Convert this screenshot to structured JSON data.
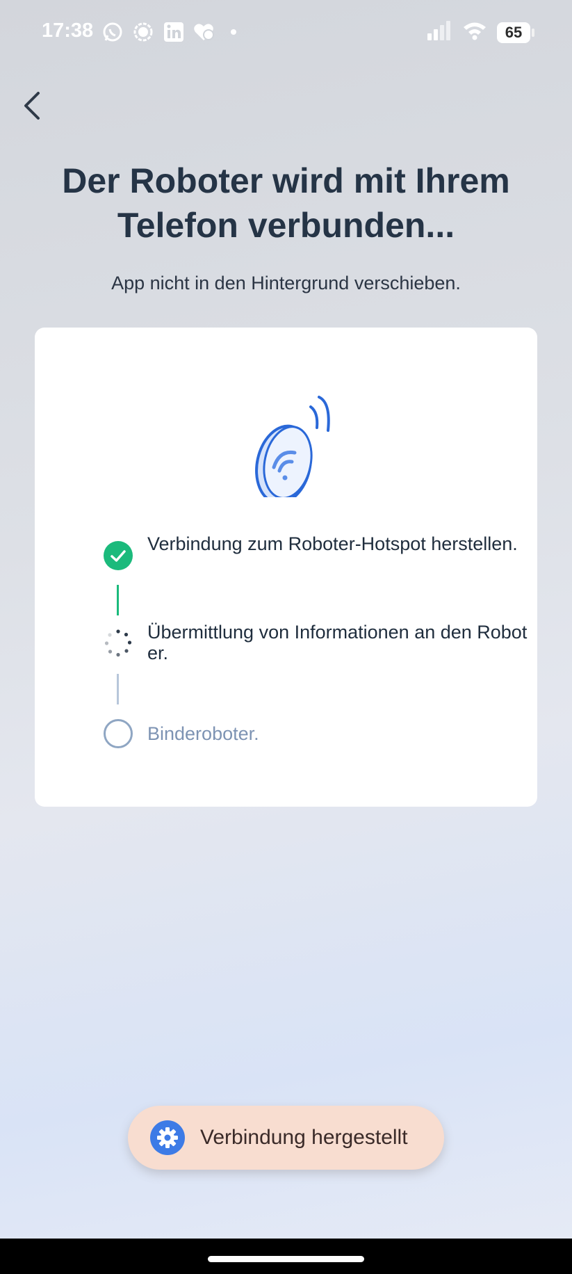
{
  "status_bar": {
    "time": "17:38",
    "battery_level": "65",
    "notification_icons": [
      "whatsapp-icon",
      "signal-icon",
      "linkedin-icon",
      "health-app-icon"
    ],
    "system_icons": [
      "cellular-signal-icon",
      "wifi-icon",
      "battery-icon"
    ]
  },
  "header": {
    "back_icon": "chevron-left-icon",
    "title": "Der Roboter wird mit Ihrem Telefon verbunden...",
    "subtitle": "App nicht in den Hintergrund verschieben."
  },
  "card": {
    "illustration": "robot-wifi-illustration",
    "steps": [
      {
        "label": "Verbindung zum Roboter-Hotspot herstellen.",
        "status": "done"
      },
      {
        "label": "Übermittlung von Informationen an den Roboter.",
        "status": "in-progress"
      },
      {
        "label": "Binderoboter.",
        "status": "pending"
      }
    ]
  },
  "toast": {
    "icon": "gear-icon",
    "label": "Verbindung hergestellt"
  },
  "colors": {
    "done": "#1bba7c",
    "pending": "#8fa6c3",
    "accent": "#3d7be6",
    "title": "#253446",
    "toast_bg": "#f8ddd0"
  }
}
